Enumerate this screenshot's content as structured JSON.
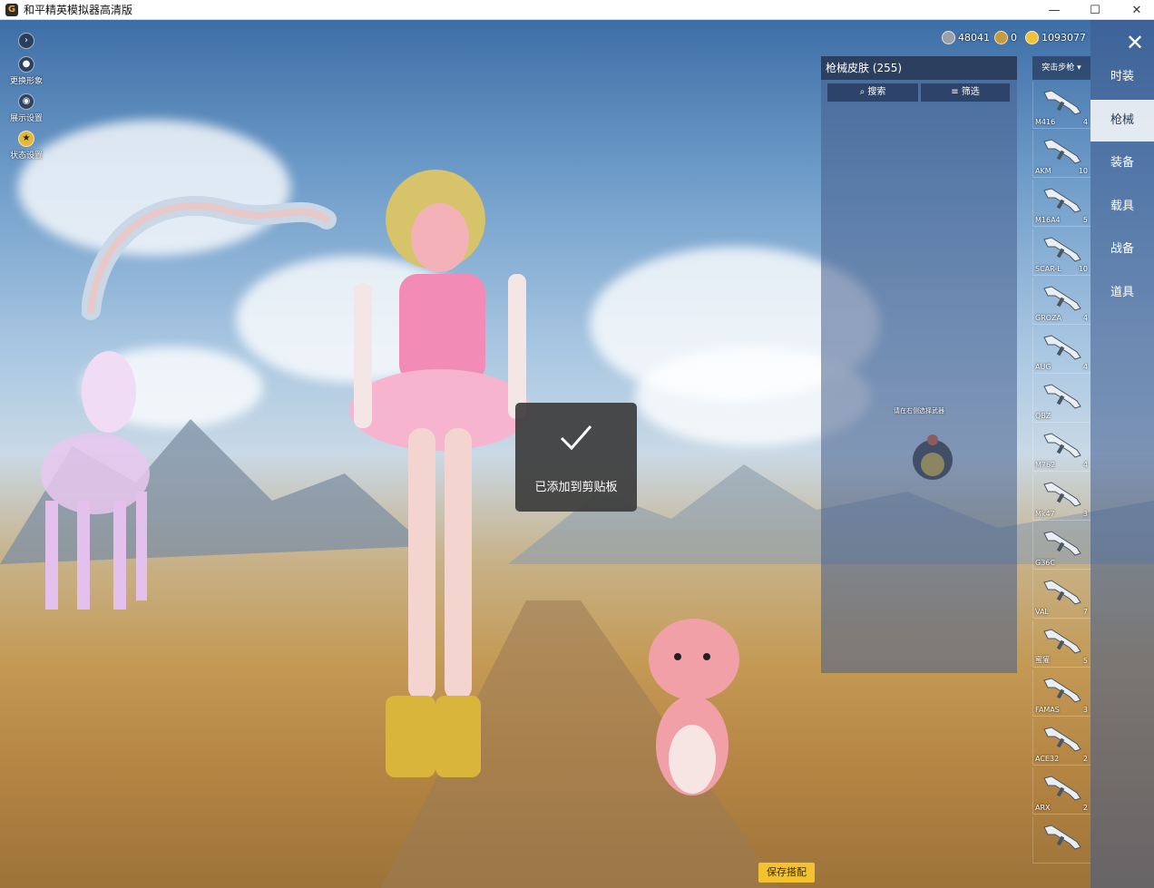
{
  "window": {
    "title": "和平精英模拟器高清版",
    "app_icon": "G",
    "min": "—",
    "max": "☐",
    "close": "✕"
  },
  "left_menu": {
    "expand_icon": "›",
    "items": [
      {
        "label": "更换形象"
      },
      {
        "label": "展示设置"
      },
      {
        "label": "状态设置"
      }
    ]
  },
  "currency": {
    "silver": "48041",
    "gold": "0",
    "coupons": "1093077"
  },
  "nav": {
    "items": [
      "时装",
      "枪械",
      "装备",
      "载具",
      "战备",
      "道具"
    ],
    "active": "枪械"
  },
  "skin_panel": {
    "title": "枪械皮肤 (255)",
    "search": "搜索",
    "filter": "筛选"
  },
  "category": {
    "selected": "突击步枪"
  },
  "guns": [
    {
      "name": "M416",
      "count": "4"
    },
    {
      "name": "AKM",
      "count": "10"
    },
    {
      "name": "M16A4",
      "count": "5"
    },
    {
      "name": "SCAR-L",
      "count": "10"
    },
    {
      "name": "GROZA",
      "count": "4"
    },
    {
      "name": "AUG",
      "count": "4"
    },
    {
      "name": "QBZ",
      "count": ""
    },
    {
      "name": "M762",
      "count": "4"
    },
    {
      "name": "Mk47",
      "count": "3"
    },
    {
      "name": "G36C",
      "count": ""
    },
    {
      "name": "VAL",
      "count": "7"
    },
    {
      "name": "蜜獾",
      "count": "5"
    },
    {
      "name": "FAMAS",
      "count": "3"
    },
    {
      "name": "ACE32",
      "count": "2"
    },
    {
      "name": "ARX",
      "count": "2"
    },
    {
      "name": "",
      "count": ""
    }
  ],
  "hint": "请在右侧选择武器",
  "toast": {
    "message": "已添加到剪贴板"
  },
  "save_button": "保存搭配"
}
